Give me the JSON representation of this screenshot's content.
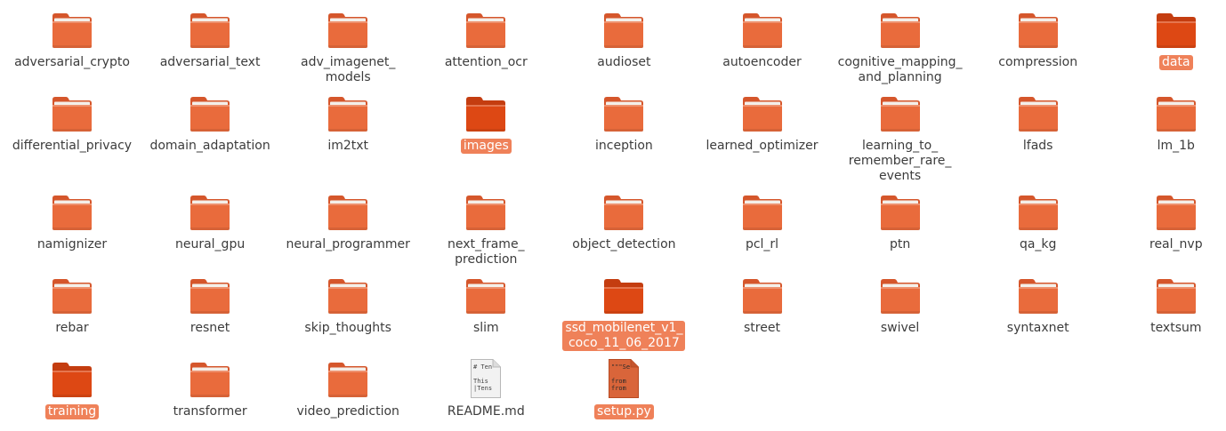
{
  "view": "icon-grid",
  "colors": {
    "folder_front": "#e96b3c",
    "folder_back": "#d5562b",
    "selected_folder": "#dd4814",
    "selected_label_bg": "#ef8159",
    "label_text": "#3c3c3c"
  },
  "items": [
    {
      "name": "adversarial_crypto",
      "type": "folder",
      "selected": false
    },
    {
      "name": "adversarial_text",
      "type": "folder",
      "selected": false
    },
    {
      "name": "adv_imagenet_\nmodels",
      "type": "folder",
      "selected": false
    },
    {
      "name": "attention_ocr",
      "type": "folder",
      "selected": false
    },
    {
      "name": "audioset",
      "type": "folder",
      "selected": false
    },
    {
      "name": "autoencoder",
      "type": "folder",
      "selected": false
    },
    {
      "name": "cognitive_mapping_\nand_planning",
      "type": "folder",
      "selected": false
    },
    {
      "name": "compression",
      "type": "folder",
      "selected": false
    },
    {
      "name": "data",
      "type": "folder",
      "selected": true
    },
    {
      "name": "differential_privacy",
      "type": "folder",
      "selected": false
    },
    {
      "name": "domain_adaptation",
      "type": "folder",
      "selected": false
    },
    {
      "name": "im2txt",
      "type": "folder",
      "selected": false
    },
    {
      "name": "images",
      "type": "folder",
      "selected": true
    },
    {
      "name": "inception",
      "type": "folder",
      "selected": false
    },
    {
      "name": "learned_optimizer",
      "type": "folder",
      "selected": false
    },
    {
      "name": "learning_to_\nremember_rare_\nevents",
      "type": "folder",
      "selected": false
    },
    {
      "name": "lfads",
      "type": "folder",
      "selected": false
    },
    {
      "name": "lm_1b",
      "type": "folder",
      "selected": false
    },
    {
      "name": "namignizer",
      "type": "folder",
      "selected": false
    },
    {
      "name": "neural_gpu",
      "type": "folder",
      "selected": false
    },
    {
      "name": "neural_programmer",
      "type": "folder",
      "selected": false
    },
    {
      "name": "next_frame_\nprediction",
      "type": "folder",
      "selected": false
    },
    {
      "name": "object_detection",
      "type": "folder",
      "selected": false
    },
    {
      "name": "pcl_rl",
      "type": "folder",
      "selected": false
    },
    {
      "name": "ptn",
      "type": "folder",
      "selected": false
    },
    {
      "name": "qa_kg",
      "type": "folder",
      "selected": false
    },
    {
      "name": "real_nvp",
      "type": "folder",
      "selected": false
    },
    {
      "name": "rebar",
      "type": "folder",
      "selected": false
    },
    {
      "name": "resnet",
      "type": "folder",
      "selected": false
    },
    {
      "name": "skip_thoughts",
      "type": "folder",
      "selected": false
    },
    {
      "name": "slim",
      "type": "folder",
      "selected": false
    },
    {
      "name": "ssd_mobilenet_v1_\ncoco_11_06_2017",
      "type": "folder",
      "selected": true
    },
    {
      "name": "street",
      "type": "folder",
      "selected": false
    },
    {
      "name": "swivel",
      "type": "folder",
      "selected": false
    },
    {
      "name": "syntaxnet",
      "type": "folder",
      "selected": false
    },
    {
      "name": "textsum",
      "type": "folder",
      "selected": false
    },
    {
      "name": "training",
      "type": "folder",
      "selected": true
    },
    {
      "name": "transformer",
      "type": "folder",
      "selected": false
    },
    {
      "name": "video_prediction",
      "type": "folder",
      "selected": false
    },
    {
      "name": "README.md",
      "type": "text-file",
      "selected": false,
      "preview": [
        "# Ten",
        "",
        "This",
        "|Tens"
      ]
    },
    {
      "name": "setup.py",
      "type": "python-file",
      "selected": true,
      "preview": [
        "\"\"\"Se",
        "",
        "from",
        "from"
      ]
    }
  ]
}
